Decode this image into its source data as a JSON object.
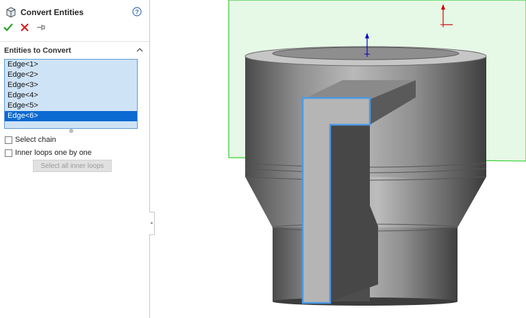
{
  "property_manager": {
    "title": "Convert Entities",
    "help_icon": "help-icon",
    "actions": {
      "ok_icon": "checkmark-icon",
      "cancel_icon": "x-icon",
      "pin_icon": "pushpin-icon"
    },
    "section": {
      "title": "Entities to Convert",
      "items": [
        "Edge<1>",
        "Edge<2>",
        "Edge<3>",
        "Edge<4>",
        "Edge<5>",
        "Edge<6>"
      ],
      "selected_item": "Edge<6>"
    },
    "select_chain_label": "Select chain",
    "inner_loops_label": "Inner loops one by one",
    "select_all_inner_loops_label": "Select all inner loops"
  },
  "viewport": {
    "sketch_plane_color": "#e6f8e6",
    "sketch_plane_edge_color": "#2fcf2f",
    "selection_color": "#4a9be8",
    "axis_y_color": "#cc0000",
    "axis_z_color": "#0000cc"
  }
}
